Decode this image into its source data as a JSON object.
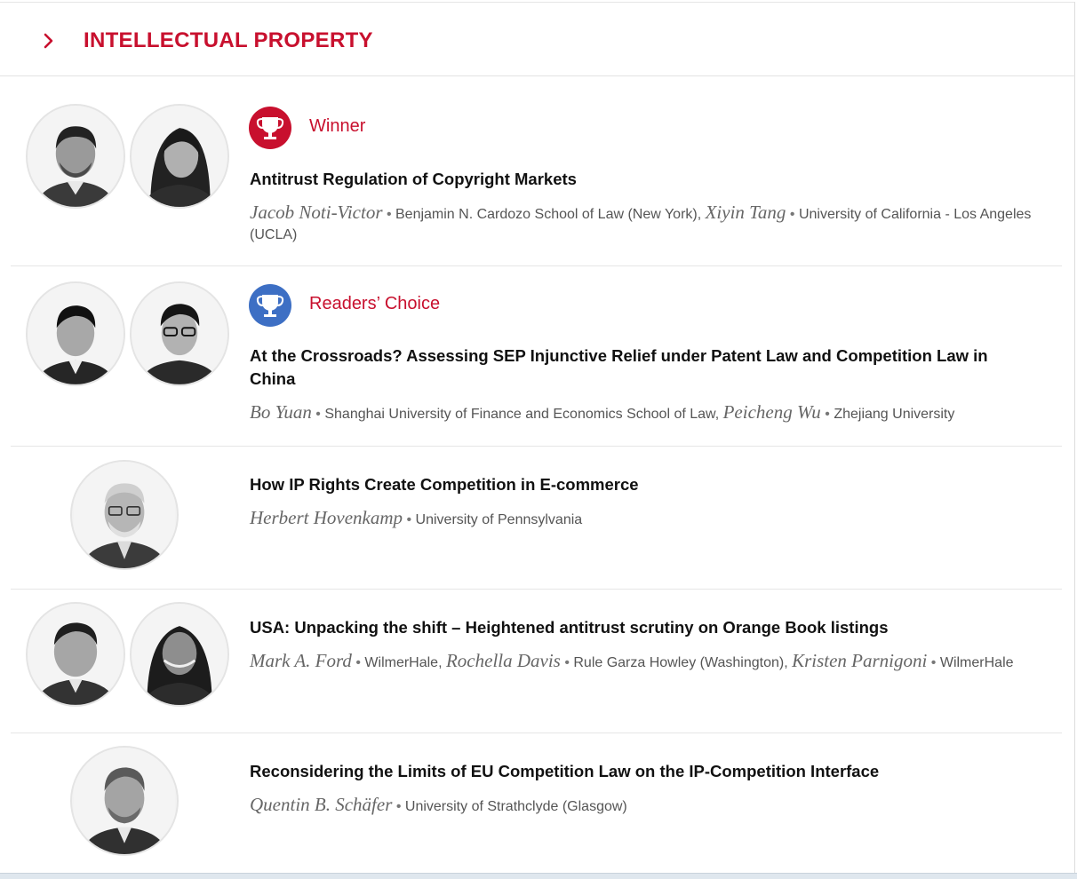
{
  "section": {
    "title": "INTELLECTUAL PROPERTY",
    "icon": "chevron-right-icon",
    "accent_color": "#c8102e"
  },
  "entries": [
    {
      "award": {
        "label": "Winner",
        "color": "#c8102e",
        "icon": "trophy-icon"
      },
      "title": "Antitrust Regulation of Copyright Markets",
      "authors": [
        {
          "name": "Jacob Noti-Victor",
          "affiliation": "Benjamin N. Cardozo School of Law (New York)"
        },
        {
          "name": "Xiyin Tang",
          "affiliation": "University of California - Los Angeles (UCLA)"
        }
      ]
    },
    {
      "award": {
        "label": "Readers’ Choice",
        "color": "#3d6fc4",
        "icon": "trophy-icon"
      },
      "title": "At the Crossroads? Assessing SEP Injunctive Relief under Patent Law and Competition Law in China",
      "authors": [
        {
          "name": "Bo Yuan",
          "affiliation": "Shanghai University of Finance and Economics School of Law"
        },
        {
          "name": "Peicheng Wu",
          "affiliation": "Zhejiang University"
        }
      ]
    },
    {
      "title": "How IP Rights Create Competition in E-commerce",
      "authors": [
        {
          "name": "Herbert Hovenkamp",
          "affiliation": "University of Pennsylvania"
        }
      ]
    },
    {
      "title": "USA: Unpacking the shift – Heightened antitrust scrutiny on Orange Book listings",
      "authors": [
        {
          "name": "Mark A. Ford",
          "affiliation": "WilmerHale"
        },
        {
          "name": "Rochella Davis",
          "affiliation": "Rule Garza Howley (Washington)"
        },
        {
          "name": "Kristen Parnigoni",
          "affiliation": "WilmerHale"
        }
      ]
    },
    {
      "title": "Reconsidering the Limits of EU Competition Law on the IP-Competition Interface",
      "authors": [
        {
          "name": "Quentin B. Schäfer",
          "affiliation": "University of Strathclyde (Glasgow)"
        }
      ]
    }
  ]
}
